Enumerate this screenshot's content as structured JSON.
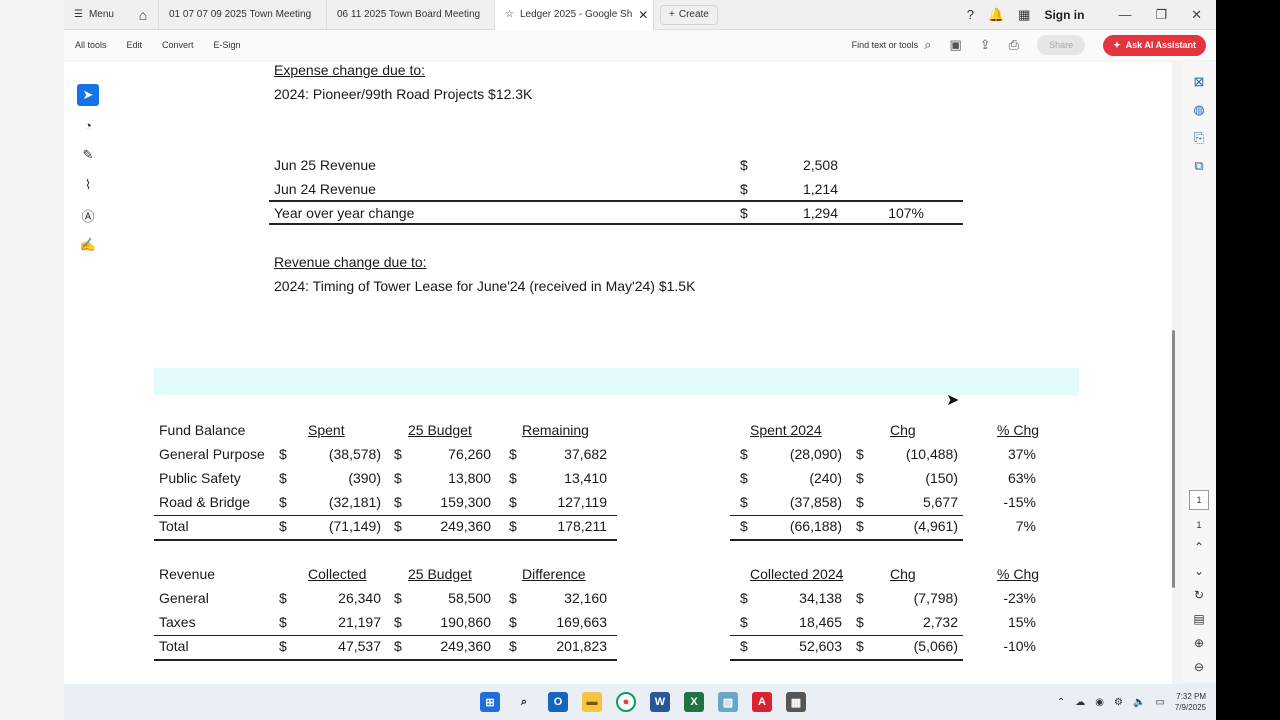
{
  "browser": {
    "menu_label": "Menu",
    "tabs": [
      {
        "label": "01 07 07 09 2025 Town Meeting"
      },
      {
        "label": "06 11 2025 Town Board Meeting"
      },
      {
        "label": "Ledger 2025 - Google Sh"
      }
    ],
    "create_label": "Create",
    "signin_label": "Sign in"
  },
  "toolbar": {
    "menus": [
      "All tools",
      "Edit",
      "Convert",
      "E-Sign"
    ],
    "find_label": "Find text or tools",
    "share_label": "Share",
    "ai_label": "Ask AI Assistant"
  },
  "document": {
    "expense_heading": "Expense change due to:",
    "expense_note": "2024: Pioneer/99th Road Projects $12.3K",
    "revenue_rows": [
      {
        "label": "Jun 25 Revenue",
        "dollar": "$",
        "value": "2,508",
        "pct": ""
      },
      {
        "label": "Jun 24 Revenue",
        "dollar": "$",
        "value": "1,214",
        "pct": ""
      },
      {
        "label": "Year over year change",
        "dollar": "$",
        "value": "1,294",
        "pct": "107%"
      }
    ],
    "revenue_heading": "Revenue change due to:",
    "revenue_note": "2024: Timing of Tower Lease for June'24 (received in May'24) $1.5K",
    "fund": {
      "headers": [
        "Fund Balance",
        "Spent",
        "25 Budget",
        "Remaining",
        "Spent 2024",
        "Chg",
        "% Chg"
      ],
      "rows": [
        {
          "name": "General Purpose",
          "spent": "(38,578)",
          "budget": "76,260",
          "remaining": "37,682",
          "spent2024": "(28,090)",
          "chg": "(10,488)",
          "pct": "37%"
        },
        {
          "name": "Public Safety",
          "spent": "(390)",
          "budget": "13,800",
          "remaining": "13,410",
          "spent2024": "(240)",
          "chg": "(150)",
          "pct": "63%"
        },
        {
          "name": "Road & Bridge",
          "spent": "(32,181)",
          "budget": "159,300",
          "remaining": "127,119",
          "spent2024": "(37,858)",
          "chg": "5,677",
          "pct": "-15%"
        },
        {
          "name": "Total",
          "spent": "(71,149)",
          "budget": "249,360",
          "remaining": "178,211",
          "spent2024": "(66,188)",
          "chg": "(4,961)",
          "pct": "7%"
        }
      ]
    },
    "revenue": {
      "headers": [
        "Revenue",
        "Collected",
        "25 Budget",
        "Difference",
        "Collected 2024",
        "Chg",
        "% Chg"
      ],
      "rows": [
        {
          "name": "General",
          "collected": "26,340",
          "budget": "58,500",
          "difference": "32,160",
          "collected2024": "34,138",
          "chg": "(7,798)",
          "pct": "-23%"
        },
        {
          "name": "Taxes",
          "collected": "21,197",
          "budget": "190,860",
          "difference": "169,663",
          "collected2024": "18,465",
          "chg": "2,732",
          "pct": "15%"
        },
        {
          "name": "Total",
          "collected": "47,537",
          "budget": "249,360",
          "difference": "201,823",
          "collected2024": "52,603",
          "chg": "(5,066)",
          "pct": "-10%"
        }
      ]
    },
    "dollar_sign": "$"
  },
  "side_panel": {
    "page_current": "1",
    "page_total": "1"
  },
  "taskbar": {
    "time": "7:32 PM",
    "date": "7/9/2025"
  }
}
